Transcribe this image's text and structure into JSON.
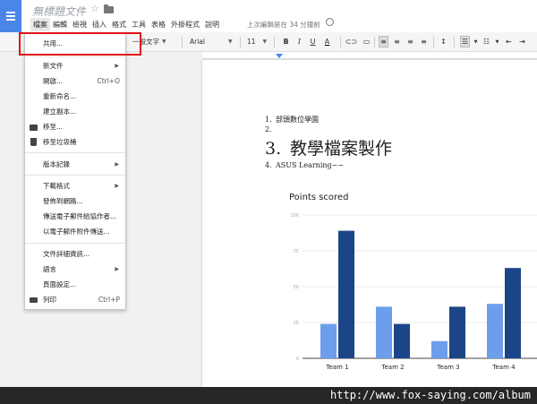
{
  "header": {
    "doc_title": "無標題文件",
    "last_edit": "上次編輯是在 34 分鐘前",
    "menus": [
      "檔案",
      "編輯",
      "檢視",
      "插入",
      "格式",
      "工具",
      "表格",
      "外掛程式",
      "說明"
    ]
  },
  "toolbar": {
    "style": "一般文字",
    "font": "Arial",
    "size": "11",
    "bold": "B",
    "italic": "I",
    "underline": "U",
    "color": "A"
  },
  "file_menu": {
    "share": "共用...",
    "new": "新文件",
    "open": "開啟...",
    "open_shortcut": "Ctrl+O",
    "rename": "重新命名...",
    "copy": "建立副本...",
    "move_to": "移至...",
    "trash": "移至垃圾桶",
    "versions": "版本記錄",
    "download": "下載格式",
    "publish": "發佈到網路...",
    "email_collab": "傳送電子郵件給協作者...",
    "email_attach": "以電子郵件附件傳送...",
    "details": "文件詳細資訊...",
    "language": "語言",
    "page_setup": "頁面設定...",
    "print": "列印",
    "print_shortcut": "Ctrl+P"
  },
  "document": {
    "line1_num": "1.",
    "line1": "部頭數位學園",
    "line2_num": "2.",
    "line3_num": "3.",
    "line3": "教學檔案製作",
    "line4_num": "4.",
    "line4": "ASUS Learning~~"
  },
  "chart_data": {
    "type": "bar",
    "title": "Points scored",
    "categories": [
      "Team 1",
      "Team 2",
      "Team 3",
      "Team 4"
    ],
    "series": [
      {
        "values": [
          24,
          36,
          12,
          38
        ],
        "color": "#6d9eeb"
      },
      {
        "values": [
          89,
          24,
          36,
          63
        ],
        "color": "#1c4587"
      }
    ],
    "ylim": [
      0,
      100
    ],
    "yticks": [
      "0",
      "25",
      "50",
      "75",
      "100"
    ],
    "grid": true
  },
  "footer": {
    "watermark": "http://www.fox-saying.com/album"
  },
  "colors": {
    "accent": "#4a86e8",
    "highlight": "#e0121a"
  }
}
